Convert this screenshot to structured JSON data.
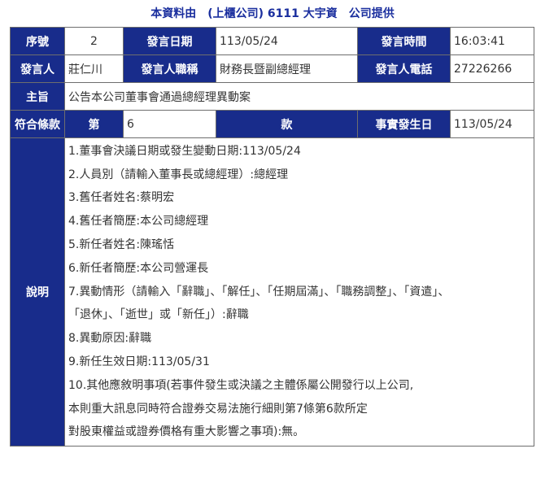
{
  "header": {
    "text": "本資料由　(上櫃公司) 6111 大宇資　公司提供"
  },
  "row1": {
    "seq_label": "序號",
    "seq_value": "2",
    "date_label": "發言日期",
    "date_value": "113/05/24",
    "time_label": "發言時間",
    "time_value": "16:03:41"
  },
  "row2": {
    "speaker_label": "發言人",
    "speaker_value": "莊仁川",
    "title_label": "發言人職稱",
    "title_value": "財務長暨副總經理",
    "phone_label": "發言人電話",
    "phone_value": "27226266"
  },
  "row3": {
    "subject_label": "主旨",
    "subject_value": "公告本公司董事會通過總經理異動案"
  },
  "row4": {
    "clause_label": "符合條款",
    "article_label": "第",
    "article_value": "6",
    "item_label": "款",
    "event_date_label": "事實發生日",
    "event_date_value": "113/05/24"
  },
  "row5": {
    "desc_label": "說明",
    "lines": [
      "1.董事會決議日期或發生變動日期:113/05/24",
      "2.人員別（請輸入董事長或總經理）:總經理",
      "3.舊任者姓名:蔡明宏",
      "4.舊任者簡歷:本公司總經理",
      "5.新任者姓名:陳瑤恬",
      "6.新任者簡歷:本公司營運長",
      "7.異動情形（請輸入「辭職」、「解任」、「任期屆滿」、「職務調整」、「資遣」、",
      "「退休」、「逝世」或「新任」）:辭職",
      "8.異動原因:辭職",
      "9.新任生效日期:113/05/31",
      "10.其他應敘明事項(若事件發生或決議之主體係屬公開發行以上公司,",
      "本則重大訊息同時符合證券交易法施行細則第7條第6款所定",
      "對股東權益或證券價格有重大影響之事項):無。"
    ]
  }
}
